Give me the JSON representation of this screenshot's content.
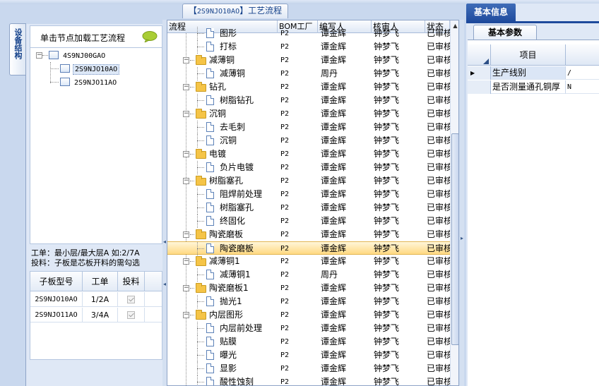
{
  "flow_panel": {
    "title_prefix": "【",
    "title_code": "2S9NJO10AO",
    "title_suffix": "】工艺流程",
    "columns": [
      "流程",
      "BOM工厂",
      "编写人",
      "核审人",
      "状态"
    ],
    "rows": [
      {
        "level": 2,
        "type": "doc",
        "name": "图形",
        "bom": "P2",
        "writer": "谭金辉",
        "reviewer": "钟梦飞",
        "status": "已审核",
        "partial": true
      },
      {
        "level": 2,
        "type": "doc",
        "name": "打标",
        "bom": "P2",
        "writer": "谭金辉",
        "reviewer": "钟梦飞",
        "status": "已审核"
      },
      {
        "level": 1,
        "type": "folder",
        "name": "减薄铜",
        "bom": "P2",
        "writer": "谭金辉",
        "reviewer": "钟梦飞",
        "status": "已审核"
      },
      {
        "level": 2,
        "type": "doc",
        "name": "减薄铜",
        "bom": "P2",
        "writer": "周丹",
        "reviewer": "钟梦飞",
        "status": "已审核"
      },
      {
        "level": 1,
        "type": "folder",
        "name": "钻孔",
        "bom": "P2",
        "writer": "谭金辉",
        "reviewer": "钟梦飞",
        "status": "已审核"
      },
      {
        "level": 2,
        "type": "doc",
        "name": "树脂钻孔",
        "bom": "P2",
        "writer": "谭金辉",
        "reviewer": "钟梦飞",
        "status": "已审核"
      },
      {
        "level": 1,
        "type": "folder",
        "name": "沉铜",
        "bom": "P2",
        "writer": "谭金辉",
        "reviewer": "钟梦飞",
        "status": "已审核"
      },
      {
        "level": 2,
        "type": "doc",
        "name": "去毛刺",
        "bom": "P2",
        "writer": "谭金辉",
        "reviewer": "钟梦飞",
        "status": "已审核"
      },
      {
        "level": 2,
        "type": "doc",
        "name": "沉铜",
        "bom": "P2",
        "writer": "谭金辉",
        "reviewer": "钟梦飞",
        "status": "已审核"
      },
      {
        "level": 1,
        "type": "folder",
        "name": "电镀",
        "bom": "P2",
        "writer": "谭金辉",
        "reviewer": "钟梦飞",
        "status": "已审核"
      },
      {
        "level": 2,
        "type": "doc",
        "name": "负片电镀",
        "bom": "P2",
        "writer": "谭金辉",
        "reviewer": "钟梦飞",
        "status": "已审核"
      },
      {
        "level": 1,
        "type": "folder",
        "name": "树脂塞孔",
        "bom": "P2",
        "writer": "谭金辉",
        "reviewer": "钟梦飞",
        "status": "已审核"
      },
      {
        "level": 2,
        "type": "doc",
        "name": "阻焊前处理",
        "bom": "P2",
        "writer": "谭金辉",
        "reviewer": "钟梦飞",
        "status": "已审核"
      },
      {
        "level": 2,
        "type": "doc",
        "name": "树脂塞孔",
        "bom": "P2",
        "writer": "谭金辉",
        "reviewer": "钟梦飞",
        "status": "已审核"
      },
      {
        "level": 2,
        "type": "doc",
        "name": "终固化",
        "bom": "P2",
        "writer": "谭金辉",
        "reviewer": "钟梦飞",
        "status": "已审核"
      },
      {
        "level": 1,
        "type": "folder",
        "name": "陶瓷磨板",
        "bom": "P2",
        "writer": "谭金辉",
        "reviewer": "钟梦飞",
        "status": "已审核"
      },
      {
        "level": 2,
        "type": "doc",
        "name": "陶瓷磨板",
        "bom": "P2",
        "writer": "谭金辉",
        "reviewer": "钟梦飞",
        "status": "已审核",
        "selected": true
      },
      {
        "level": 1,
        "type": "folder",
        "name": "减薄铜1",
        "bom": "P2",
        "writer": "谭金辉",
        "reviewer": "钟梦飞",
        "status": "已审核"
      },
      {
        "level": 2,
        "type": "doc",
        "name": "减薄铜1",
        "bom": "P2",
        "writer": "周丹",
        "reviewer": "钟梦飞",
        "status": "已审核"
      },
      {
        "level": 1,
        "type": "folder",
        "name": "陶瓷磨板1",
        "bom": "P2",
        "writer": "谭金辉",
        "reviewer": "钟梦飞",
        "status": "已审核"
      },
      {
        "level": 2,
        "type": "doc",
        "name": "抛光1",
        "bom": "P2",
        "writer": "谭金辉",
        "reviewer": "钟梦飞",
        "status": "已审核"
      },
      {
        "level": 1,
        "type": "folder",
        "name": "内层图形",
        "bom": "P2",
        "writer": "谭金辉",
        "reviewer": "钟梦飞",
        "status": "已审核"
      },
      {
        "level": 2,
        "type": "doc",
        "name": "内层前处理",
        "bom": "P2",
        "writer": "谭金辉",
        "reviewer": "钟梦飞",
        "status": "已审核"
      },
      {
        "level": 2,
        "type": "doc",
        "name": "贴膜",
        "bom": "P2",
        "writer": "谭金辉",
        "reviewer": "钟梦飞",
        "status": "已审核"
      },
      {
        "level": 2,
        "type": "doc",
        "name": "曝光",
        "bom": "P2",
        "writer": "谭金辉",
        "reviewer": "钟梦飞",
        "status": "已审核"
      },
      {
        "level": 2,
        "type": "doc",
        "name": "显影",
        "bom": "P2",
        "writer": "谭金辉",
        "reviewer": "钟梦飞",
        "status": "已审核"
      },
      {
        "level": 2,
        "type": "doc",
        "name": "酸性蚀刻",
        "bom": "P2",
        "writer": "谭金辉",
        "reviewer": "钟梦飞",
        "status": "已审核"
      }
    ]
  },
  "left_panel": {
    "vertical_tab": "设备结构",
    "hint": "单击节点加载工艺流程",
    "hint_icon": "speech-bubble-icon",
    "tree": {
      "root": "4S9NJ00GAO",
      "children": [
        "2S9NJO10AO",
        "2S9NJO11AO"
      ],
      "selected_index": 0
    },
    "note_line1": "工单：最小层/最大层A 如:2/7A",
    "note_line2": "投料：子板是芯板开料的需勾选",
    "sub_grid": {
      "columns": [
        "子板型号",
        "工单",
        "投料"
      ],
      "rows": [
        {
          "model": "2S9NJO10AO",
          "order": "1/2A",
          "feed": true
        },
        {
          "model": "2S9NJO11AO",
          "order": "3/4A",
          "feed": true
        }
      ]
    }
  },
  "right_panel": {
    "title": "基本信息",
    "tab": "基本参数",
    "column": "项目",
    "rows": [
      {
        "name": "生产线别",
        "value": "/",
        "selected": true
      },
      {
        "name": "是否测量通孔铜厚",
        "value": "N"
      }
    ]
  },
  "colors": {
    "accent": "#1e4a9c",
    "selection": "#ffd982",
    "panel_bg": "#dfe8f6"
  }
}
